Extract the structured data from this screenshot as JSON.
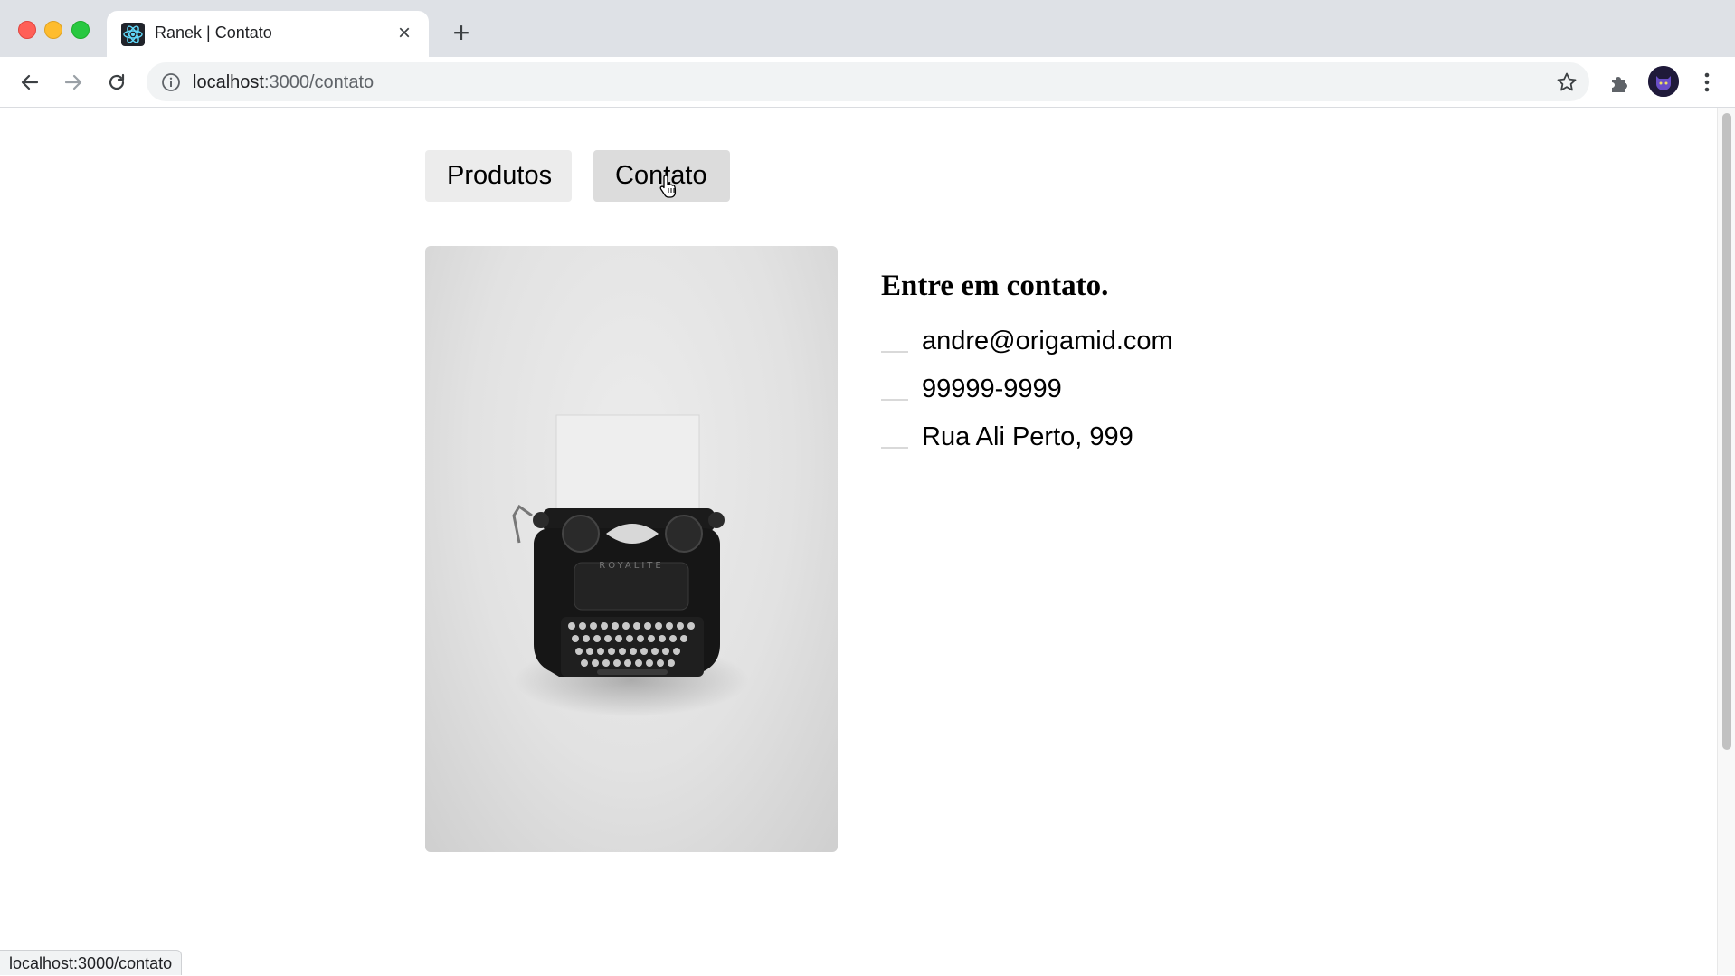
{
  "browser": {
    "tab_title": "Ranek | Contato",
    "tab_close_label": "×",
    "new_tab_label": "+",
    "url_host": "localhost",
    "url_rest": ":3000/contato",
    "status_url": "localhost:3000/contato"
  },
  "nav": {
    "produtos_label": "Produtos",
    "contato_label": "Contato"
  },
  "contact": {
    "heading": "Entre em contato.",
    "items": [
      {
        "text": "andre@origamid.com"
      },
      {
        "text": "99999-9999"
      },
      {
        "text": "Rua Ali Perto, 999"
      }
    ]
  },
  "icons": {
    "favicon": "react-atom-icon",
    "back": "arrow-left-icon",
    "forward": "arrow-right-icon",
    "reload": "reload-icon",
    "info": "info-icon",
    "bookmark": "star-icon",
    "extensions": "puzzle-icon",
    "profile": "avatar",
    "menu": "kebab-menu-icon"
  },
  "colors": {
    "tabstrip": "#dee1e6",
    "nav_button": "#ececec",
    "nav_button_hover": "#dcdcdc",
    "list_dash": "#d9d9d9"
  }
}
